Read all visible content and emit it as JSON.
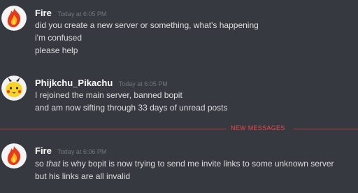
{
  "messages": [
    {
      "author": "Fire",
      "timestamp": "Today at 6:05 PM",
      "lines": [
        "did you create a new server or something, what's happening",
        "i'm confused",
        "please help"
      ]
    },
    {
      "author": "Phijkchu_Pikachu",
      "timestamp": "Today at 6:05 PM",
      "lines": [
        "I rejoined the main server, banned bopit",
        "and am now sifting through 33 days of unread posts"
      ]
    },
    {
      "author": "Fire",
      "timestamp": "Today at 6:06 PM",
      "lines": [
        {
          "pre": "so ",
          "em": "that",
          "post": " is why bopit is now trying to send me invite links to some unknown server"
        },
        "but his links are all invalid"
      ]
    }
  ],
  "divider": {
    "label": "NEW MESSAGES"
  },
  "colors": {
    "background": "#36393f",
    "text": "#dcddde",
    "username": "#ffffff",
    "timestamp": "#72767d",
    "new_messages": "#f04747"
  }
}
